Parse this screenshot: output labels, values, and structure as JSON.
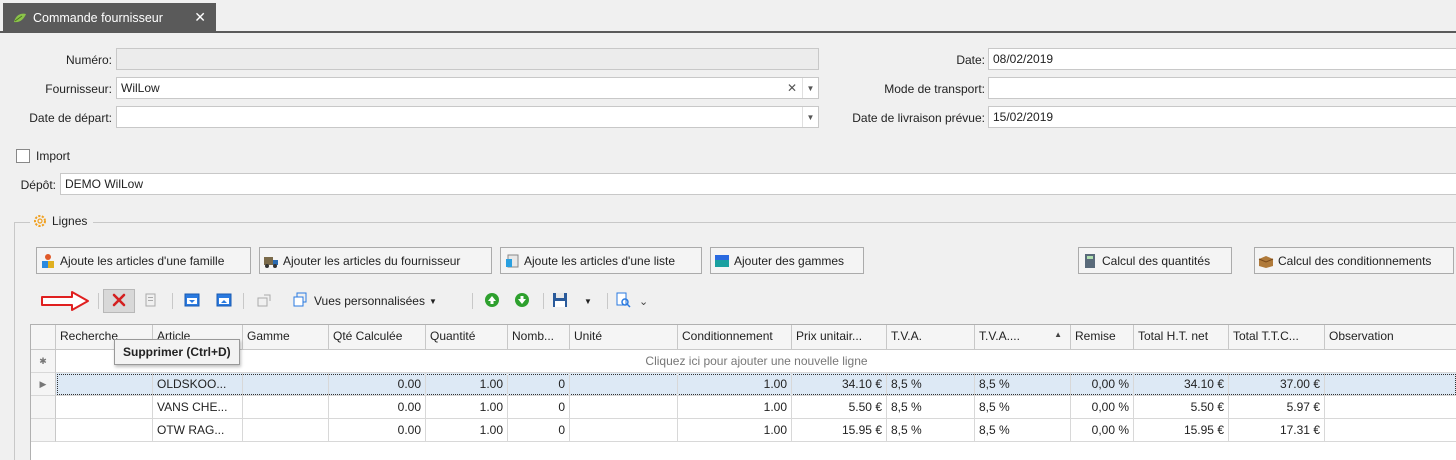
{
  "tab": {
    "title": "Commande fournisseur",
    "close": "✕"
  },
  "form": {
    "numero_label": "Numéro:",
    "numero_value": "",
    "fournisseur_label": "Fournisseur:",
    "fournisseur_value": "WilLow",
    "date_depart_label": "Date de départ:",
    "date_depart_value": "",
    "date_label": "Date:",
    "date_value": "08/02/2019",
    "transport_label": "Mode de transport:",
    "transport_value": "",
    "livraison_label": "Date de livraison prévue:",
    "livraison_value": "15/02/2019",
    "import_label": "Import",
    "import_checked": false,
    "depot_label": "Dépôt:",
    "depot_value": "DEMO WilLow"
  },
  "lignes": {
    "legend": "Lignes",
    "buttons": {
      "famille": "Ajoute les articles d'une famille",
      "fournisseur": "Ajouter les articles du fournisseur",
      "liste": "Ajoute les articles d'une liste",
      "gammes": "Ajouter des gammes",
      "quantites": "Calcul des quantités",
      "conditionnements": "Calcul des conditionnements"
    },
    "toolbar": {
      "vues": "Vues personnalisées",
      "tooltip": "Supprimer (Ctrl+D)"
    }
  },
  "grid": {
    "columns": [
      "Recherche",
      "Article",
      "Gamme",
      "Qté Calculée",
      "Quantité",
      "Nomb...",
      "Unité",
      "Conditionnement",
      "Prix unitair...",
      "T.V.A.",
      "T.V.A....",
      "Remise",
      "Total H.T. net",
      "Total T.T.C...",
      "Observation"
    ],
    "new_row_hint": "Cliquez ici pour ajouter une nouvelle ligne",
    "rows": [
      [
        "",
        "OLDSKOO...",
        "",
        "0.00",
        "1.00",
        "0",
        "",
        "1.00",
        "34.10 €",
        "8,5 %",
        "8,5 %",
        "0,00 %",
        "34.10 €",
        "37.00 €",
        ""
      ],
      [
        "",
        "VANS CHE...",
        "",
        "0.00",
        "1.00",
        "0",
        "",
        "1.00",
        "5.50 €",
        "8,5 %",
        "8,5 %",
        "0,00 %",
        "5.50 €",
        "5.97 €",
        ""
      ],
      [
        "",
        "OTW RAG...",
        "",
        "0.00",
        "1.00",
        "0",
        "",
        "1.00",
        "15.95 €",
        "8,5 %",
        "8,5 %",
        "0,00 %",
        "15.95 €",
        "17.31 €",
        ""
      ]
    ]
  },
  "colors": {
    "tab_bg": "#5a5a5a",
    "selected_row": "#dde9f5",
    "arrow": "#e02020",
    "delete": "#d42020"
  }
}
